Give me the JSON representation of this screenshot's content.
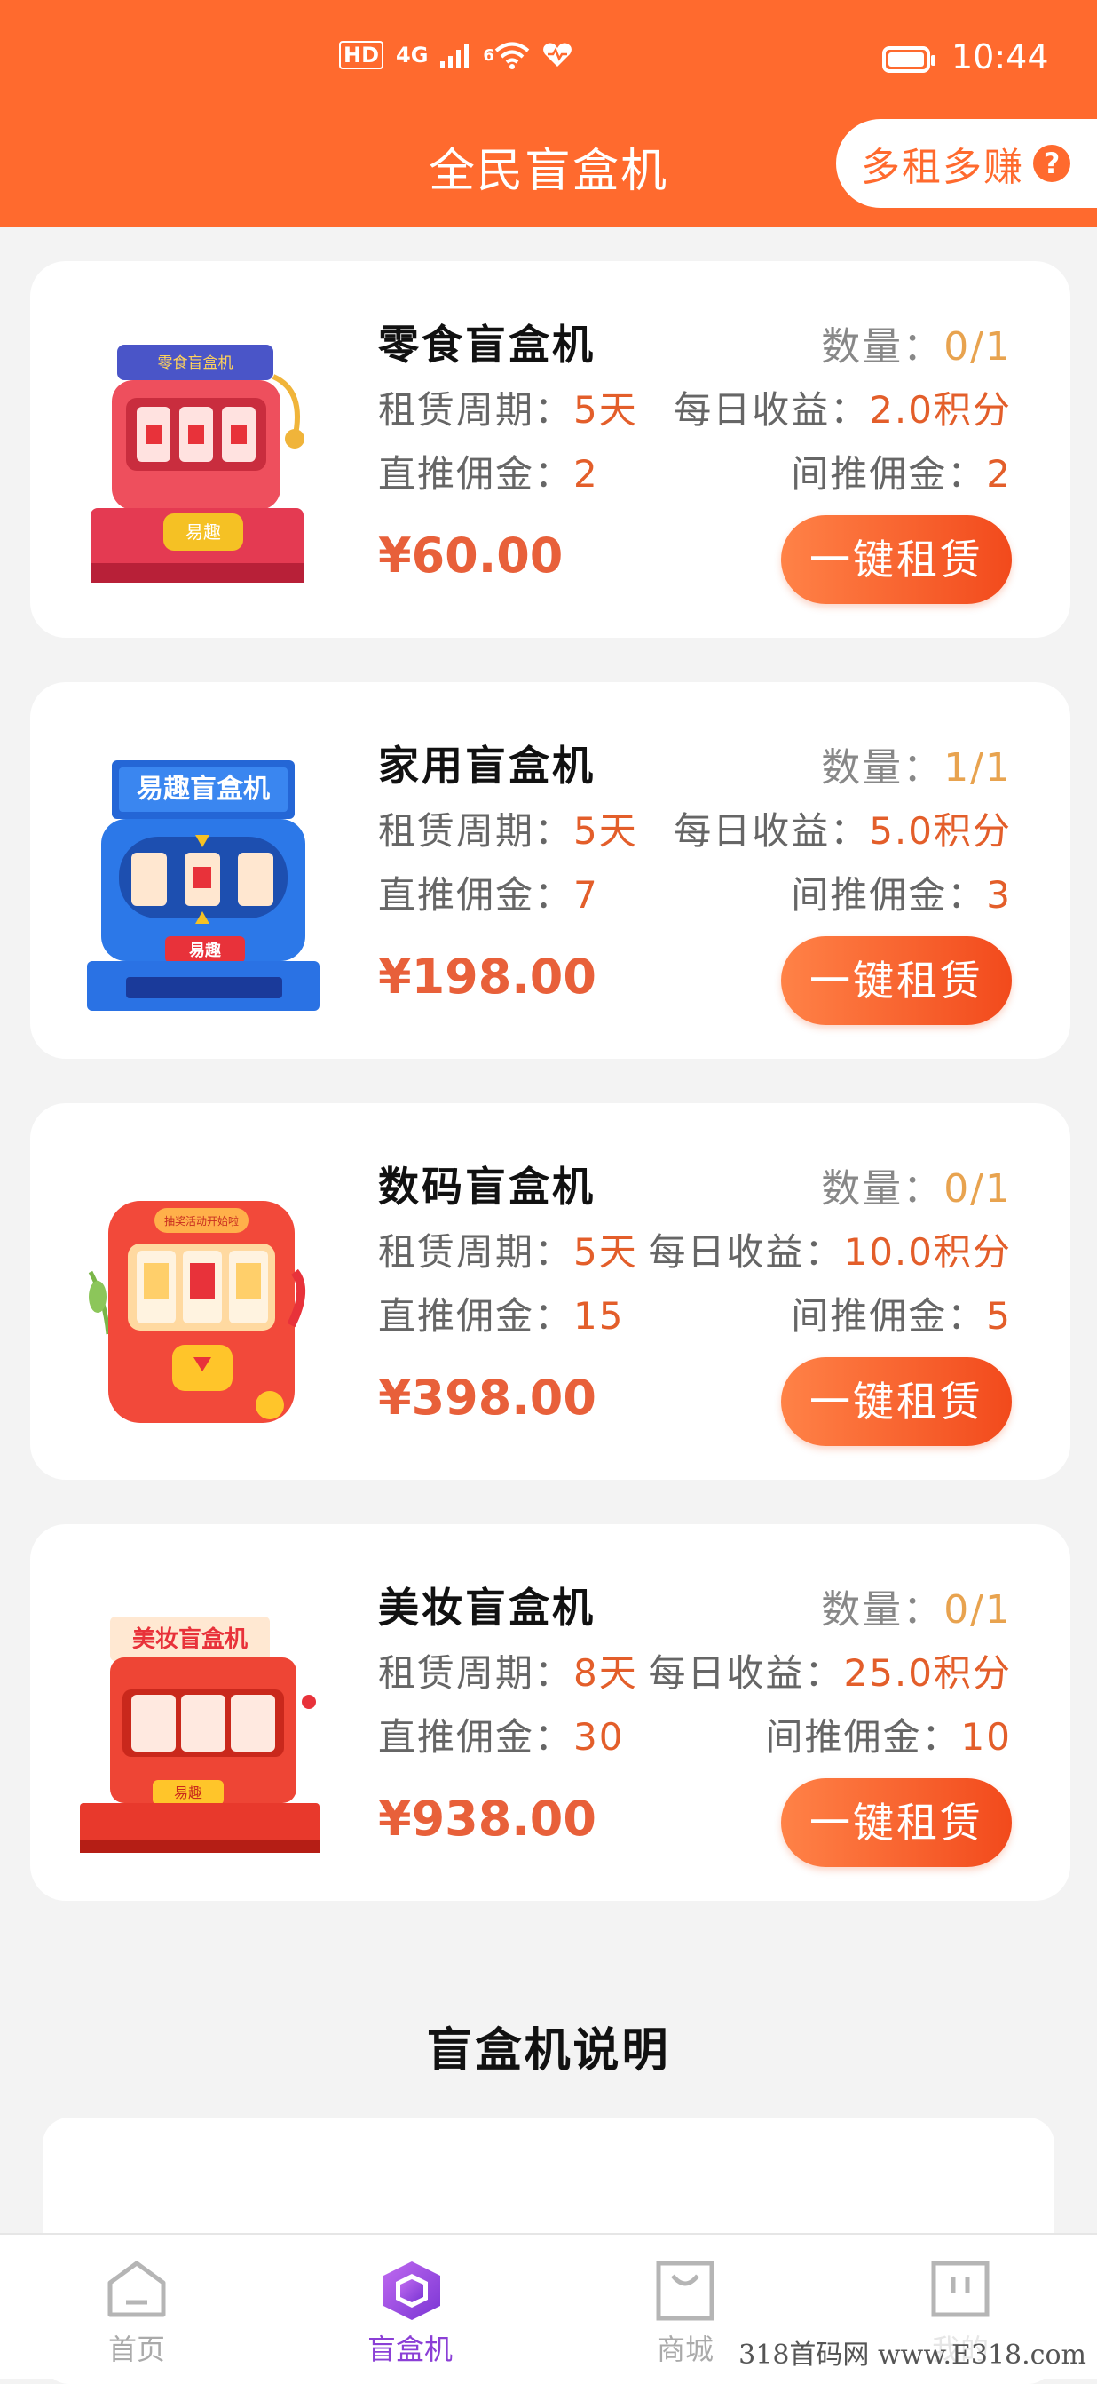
{
  "status_bar": {
    "network_hd": "HD",
    "network_4g": "4G",
    "wifi_badge": "6",
    "time": "10:44",
    "battery_level": 1.0
  },
  "header": {
    "title": "全民盲盒机",
    "promo_label": "多租多赚",
    "help_glyph": "?"
  },
  "labels": {
    "quantity": "数量：",
    "period": "租赁周期：",
    "daily": "每日收益：",
    "direct": "直推佣金：",
    "indirect": "间推佣金：",
    "rent_button": "一键租赁"
  },
  "machines": [
    {
      "name": "零食盲盒机",
      "quantity": "0/1",
      "period": "5天",
      "daily": "2.0积分",
      "direct": "2",
      "indirect": "2",
      "price": "¥60.00",
      "sign_text": "零食盲盒机",
      "button_text": "易趣"
    },
    {
      "name": "家用盲盒机",
      "quantity": "1/1",
      "period": "5天",
      "daily": "5.0积分",
      "direct": "7",
      "indirect": "3",
      "price": "¥198.00",
      "sign_text": "易趣盲盒机",
      "button_text": "易趣"
    },
    {
      "name": "数码盲盒机",
      "quantity": "0/1",
      "period": "5天",
      "daily": "10.0积分",
      "direct": "15",
      "indirect": "5",
      "price": "¥398.00",
      "sign_text": "抽奖活动开始啦",
      "button_text": ""
    },
    {
      "name": "美妆盲盒机",
      "quantity": "0/1",
      "period": "8天",
      "daily": "25.0积分",
      "direct": "30",
      "indirect": "10",
      "price": "¥938.00",
      "sign_text": "美妆盲盒机",
      "button_text": "易趣"
    }
  ],
  "explanation": {
    "title": "盲盒机说明"
  },
  "bottom_nav": {
    "items": [
      {
        "label": "首页",
        "icon": "home-icon",
        "active": false
      },
      {
        "label": "盲盒机",
        "icon": "blindbox-icon",
        "active": true
      },
      {
        "label": "商城",
        "icon": "shop-bag-icon",
        "active": false
      },
      {
        "label": "我的",
        "icon": "profile-icon",
        "active": false
      }
    ]
  },
  "watermark": "318首码网 www.E318.com",
  "colors": {
    "brand_orange": "#ff6a2e",
    "price_red": "#e8603a",
    "value_orange": "#e35e2a",
    "quantity_gold": "#e8a34f",
    "nav_active_purple": "#8b3fd6"
  }
}
